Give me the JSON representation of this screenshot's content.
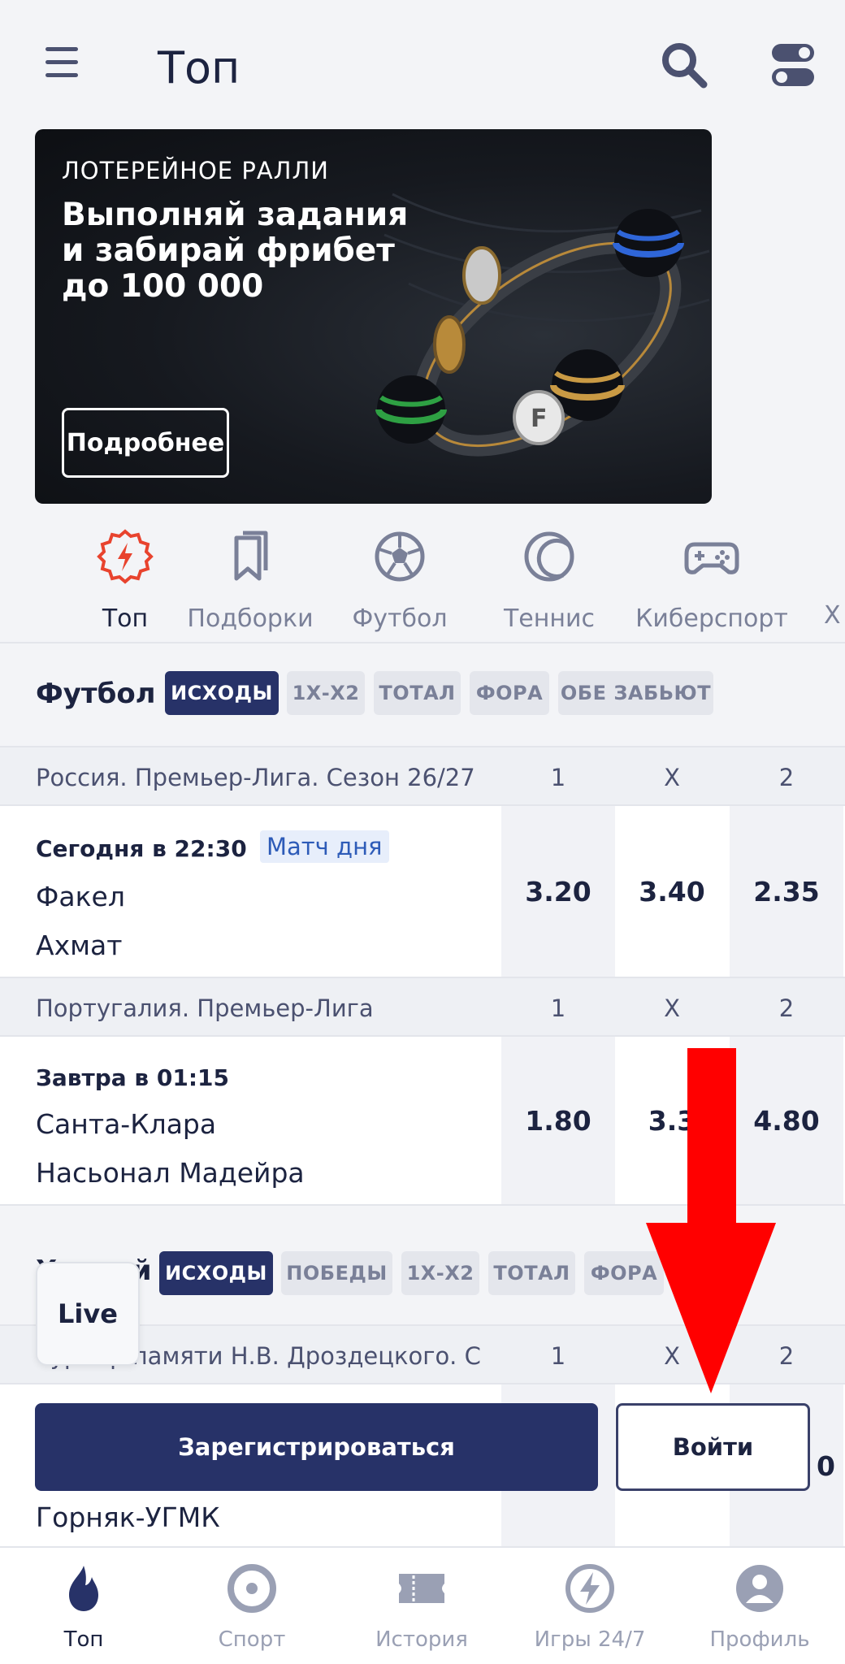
{
  "header": {
    "title": "Топ"
  },
  "banner": {
    "kicker": "ЛОТЕРЕЙНОЕ РАЛЛИ",
    "title": "Выполняй задания и забирай фрибет до 100 000",
    "button": "Подробнее"
  },
  "categories": [
    {
      "label": "Топ",
      "icon": "lightning-badge-icon",
      "active": true
    },
    {
      "label": "Подборки",
      "icon": "bookmarks-icon"
    },
    {
      "label": "Футбол",
      "icon": "soccer-ball-icon"
    },
    {
      "label": "Теннис",
      "icon": "tennis-ball-icon"
    },
    {
      "label": "Киберспорт",
      "icon": "gamepad-icon"
    },
    {
      "label": "Х",
      "icon": "hockey-icon"
    }
  ],
  "football": {
    "title": "Футбол",
    "chips": [
      "ИСХОДЫ",
      "1Х-Х2",
      "ТОТАЛ",
      "ФОРА",
      "ОБЕ ЗАБЬЮТ"
    ],
    "leagues": [
      {
        "name": "Россия. Премьер-Лига. Сезон 26/27",
        "cols": [
          "1",
          "X",
          "2"
        ],
        "match": {
          "time": "Сегодня в 22:30",
          "badge": "Матч дня",
          "team1": "Факел",
          "team2": "Ахмат",
          "odds": [
            "3.20",
            "3.40",
            "2.35"
          ]
        }
      },
      {
        "name": "Португалия. Премьер-Лига",
        "cols": [
          "1",
          "X",
          "2"
        ],
        "match": {
          "time": "Завтра в 01:15",
          "team1": "Санта-Клара",
          "team2": "Насьонал Мадейра",
          "odds": [
            "1.80",
            "3.3",
            "4.80"
          ]
        }
      }
    ]
  },
  "hockey": {
    "title": "Хоккей",
    "chips": [
      "ИСХОДЫ",
      "ПОБЕДЫ",
      "1Х-Х2",
      "ТОТАЛ",
      "ФОРА"
    ],
    "league": {
      "name": "Турнир памяти Н.В. Дроздецкого. С",
      "cols": [
        "1",
        "X",
        "2"
      ]
    },
    "team": "Горняк-УГМК",
    "odd_tail": "0"
  },
  "live": "Live",
  "auth": {
    "register": "Зарегистрироваться",
    "login": "Войти"
  },
  "bottom_nav": [
    {
      "label": "Топ",
      "icon": "flame-icon",
      "active": true
    },
    {
      "label": "Спорт",
      "icon": "target-icon"
    },
    {
      "label": "История",
      "icon": "ticket-icon"
    },
    {
      "label": "Игры 24/7",
      "icon": "lightning-circle-icon"
    },
    {
      "label": "Профиль",
      "icon": "user-icon"
    }
  ],
  "colors": {
    "primary": "#273268",
    "accent_red": "#e8432e",
    "arrow": "#ff0000"
  }
}
